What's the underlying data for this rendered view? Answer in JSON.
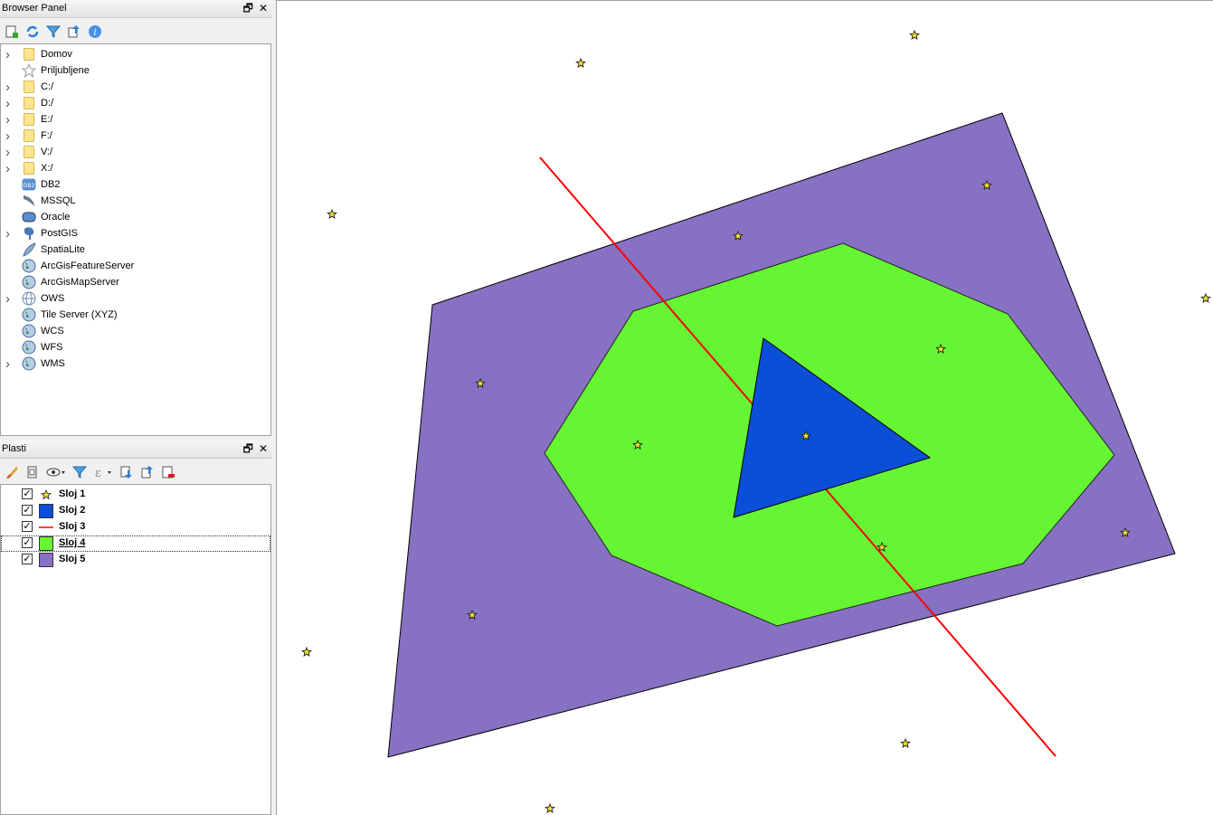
{
  "browser_panel": {
    "title": "Browser Panel",
    "items": [
      {
        "label": "Domov",
        "icon": "folder-icon",
        "expandable": true
      },
      {
        "label": "Priljubljene",
        "icon": "star-icon",
        "expandable": false
      },
      {
        "label": "C:/",
        "icon": "folder-icon",
        "expandable": true
      },
      {
        "label": "D:/",
        "icon": "folder-icon",
        "expandable": true
      },
      {
        "label": "E:/",
        "icon": "folder-icon",
        "expandable": true
      },
      {
        "label": "F:/",
        "icon": "folder-icon",
        "expandable": true
      },
      {
        "label": "V:/",
        "icon": "folder-icon",
        "expandable": true
      },
      {
        "label": "X:/",
        "icon": "folder-icon",
        "expandable": true
      },
      {
        "label": "DB2",
        "icon": "db2-icon",
        "expandable": false
      },
      {
        "label": "MSSQL",
        "icon": "mssql-icon",
        "expandable": false
      },
      {
        "label": "Oracle",
        "icon": "oracle-icon",
        "expandable": false
      },
      {
        "label": "PostGIS",
        "icon": "postgis-elephant-icon",
        "expandable": true
      },
      {
        "label": "SpatiaLite",
        "icon": "spatialite-feather-icon",
        "expandable": false
      },
      {
        "label": "ArcGisFeatureServer",
        "icon": "globe-icon",
        "expandable": false
      },
      {
        "label": "ArcGisMapServer",
        "icon": "globe-icon",
        "expandable": false
      },
      {
        "label": "OWS",
        "icon": "globe-grid-icon",
        "expandable": true
      },
      {
        "label": "Tile Server (XYZ)",
        "icon": "globe-icon",
        "expandable": false
      },
      {
        "label": "WCS",
        "icon": "globe-icon",
        "expandable": false
      },
      {
        "label": "WFS",
        "icon": "globe-icon",
        "expandable": false
      },
      {
        "label": "WMS",
        "icon": "globe-icon",
        "expandable": true
      }
    ]
  },
  "layers_panel": {
    "title": "Plasti",
    "layers": [
      {
        "name": "Sloj 1",
        "symbol": "point-star",
        "color": "#f5e12a",
        "checked": true,
        "selected": false
      },
      {
        "name": "Sloj 2",
        "symbol": "fill",
        "color": "#0b4ed8",
        "checked": true,
        "selected": false
      },
      {
        "name": "Sloj 3",
        "symbol": "line",
        "color": "#ff0000",
        "checked": true,
        "selected": false
      },
      {
        "name": "Sloj 4",
        "symbol": "fill",
        "color": "#66f533",
        "checked": true,
        "selected": true
      },
      {
        "name": "Sloj 5",
        "symbol": "fill",
        "color": "#8771c2",
        "checked": true,
        "selected": false
      }
    ]
  },
  "map": {
    "colors": {
      "sloj5_fill": "#8771c2",
      "sloj4_fill": "#66f533",
      "sloj2_fill": "#0b4ed8",
      "sloj3_stroke": "#ff0000",
      "sloj1_fill": "#f5e12a"
    }
  }
}
